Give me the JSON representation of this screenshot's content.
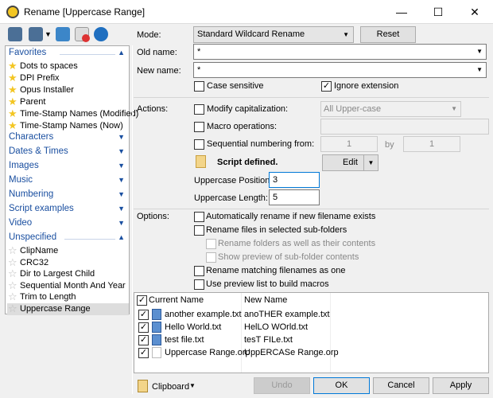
{
  "window": {
    "title": "Rename [Uppercase Range]",
    "minimize": "—",
    "maximize": "☐",
    "close": "✕"
  },
  "toolbar": [
    "load-preset-icon",
    "save-preset-icon",
    "print-icon",
    "delete-icon",
    "refresh-icon"
  ],
  "sidebar": {
    "favorites": {
      "label": "Favorites",
      "items": [
        "Dots to spaces",
        "DPI Prefix",
        "Opus Installer",
        "Parent",
        "Time-Stamp Names (Modified)",
        "Time-Stamp Names (Now)"
      ]
    },
    "groups": [
      "Characters",
      "Dates & Times",
      "Images",
      "Music",
      "Numbering",
      "Script examples",
      "Video"
    ],
    "unspecified": {
      "label": "Unspecified",
      "items": [
        "ClipName",
        "CRC32",
        "Dir to Largest Child",
        "Sequential Month And Year",
        "Trim to Length",
        "Uppercase Range"
      ],
      "selected": "Uppercase Range"
    }
  },
  "form": {
    "mode_label": "Mode:",
    "mode_value": "Standard Wildcard Rename",
    "reset": "Reset",
    "old_name_label": "Old name:",
    "old_name_value": "*",
    "new_name_label": "New name:",
    "new_name_value": "*",
    "case_sensitive": "Case sensitive",
    "case_sensitive_checked": false,
    "ignore_extension": "Ignore extension",
    "ignore_extension_checked": true,
    "actions_label": "Actions:",
    "modify_cap": "Modify capitalization:",
    "modify_cap_value": "All Upper-case",
    "macro_ops": "Macro operations:",
    "seq_num": "Sequential numbering from:",
    "seq_from": "1",
    "seq_by_label": "by",
    "seq_by": "1",
    "script_defined": "Script defined.",
    "edit": "Edit",
    "upper_pos_label": "Uppercase Position:",
    "upper_pos": "3",
    "upper_len_label": "Uppercase Length:",
    "upper_len": "5",
    "options_label": "Options:",
    "options": [
      {
        "label": "Automatically rename if new filename exists",
        "checked": false,
        "disabled": false
      },
      {
        "label": "Rename files in selected sub-folders",
        "checked": false,
        "disabled": false
      },
      {
        "label": "Rename folders as well as their contents",
        "checked": false,
        "disabled": true
      },
      {
        "label": "Show preview of sub-folder contents",
        "checked": false,
        "disabled": true
      },
      {
        "label": "Rename matching filenames as one",
        "checked": false,
        "disabled": false
      },
      {
        "label": "Use preview list to build macros",
        "checked": false,
        "disabled": false
      }
    ]
  },
  "preview": {
    "col_current": "Current Name",
    "col_new": "New Name",
    "rows": [
      {
        "current": "another example.txt",
        "new": "anoTHER example.txt",
        "icon": "text-file-icon"
      },
      {
        "current": "Hello World.txt",
        "new": "HelLO WOrld.txt",
        "icon": "text-file-icon"
      },
      {
        "current": "test file.txt",
        "new": "tesT FILe.txt",
        "icon": "text-file-icon"
      },
      {
        "current": "Uppercase Range.orp",
        "new": "UppERCASe Range.orp",
        "icon": "blank-file-icon"
      }
    ]
  },
  "footer": {
    "clipboard": "Clipboard",
    "undo": "Undo",
    "ok": "OK",
    "cancel": "Cancel",
    "apply": "Apply"
  },
  "colors": {
    "accent": "#0078d7",
    "group_header": "#1a4fa0",
    "star": "#f3c623"
  }
}
